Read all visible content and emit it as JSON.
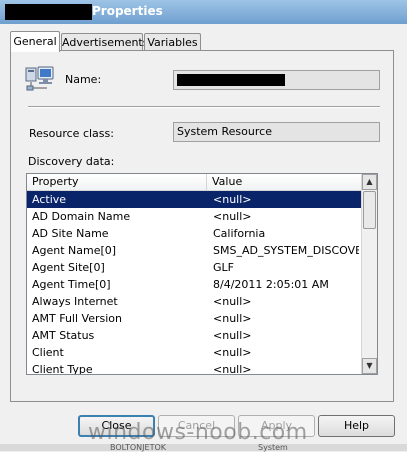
{
  "window": {
    "title": "Properties"
  },
  "tabs": [
    {
      "label": "General",
      "active": true
    },
    {
      "label": "Advertisements",
      "active": false
    },
    {
      "label": "Variables",
      "active": false
    }
  ],
  "general": {
    "name_label": "Name:",
    "resource_class_label": "Resource class:",
    "resource_class_value": "System Resource",
    "discovery_label": "Discovery data:"
  },
  "discovery_table": {
    "columns": [
      "Property",
      "Value"
    ],
    "rows": [
      {
        "property": "Active",
        "value": "<null>",
        "selected": true
      },
      {
        "property": "AD Domain Name",
        "value": "<null>"
      },
      {
        "property": "AD Site Name",
        "value": "California"
      },
      {
        "property": "Agent Name[0]",
        "value": "SMS_AD_SYSTEM_DISCOVERY_"
      },
      {
        "property": "Agent Site[0]",
        "value": "GLF"
      },
      {
        "property": "Agent Time[0]",
        "value": "8/4/2011 2:05:01 AM"
      },
      {
        "property": "Always Internet",
        "value": "<null>"
      },
      {
        "property": "AMT Full Version",
        "value": "<null>"
      },
      {
        "property": "AMT Status",
        "value": "<null>"
      },
      {
        "property": "Client",
        "value": "<null>"
      },
      {
        "property": "Client Type",
        "value": "<null>"
      }
    ]
  },
  "buttons": {
    "close": "Close",
    "cancel": "Cancel",
    "apply": "Apply",
    "help": "Help"
  },
  "watermark": "windows-noob.com",
  "background_strip": {
    "left": "BOLTONJETOK",
    "right": "System"
  },
  "colors": {
    "selection": "#0a246a",
    "title_bar": "#7aa7d4"
  }
}
